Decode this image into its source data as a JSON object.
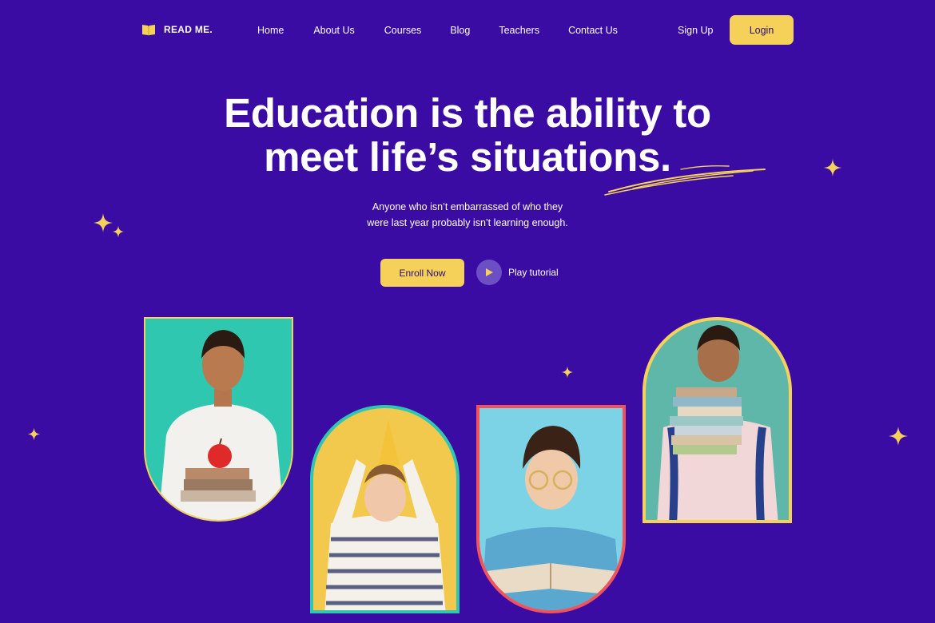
{
  "brand": {
    "name": "READ ME.",
    "icon": "book-icon"
  },
  "nav": {
    "links": [
      "Home",
      "About Us",
      "Courses",
      "Blog",
      "Teachers",
      "Contact Us"
    ],
    "signup": "Sign Up",
    "login": "Login"
  },
  "hero": {
    "title_line1": "Education is the ability to",
    "title_line2": "meet life’s situations.",
    "subtitle_line1": "Anyone who isn’t embarrassed of who they",
    "subtitle_line2": "were last year probably isn’t learning enough.",
    "enroll": "Enroll Now",
    "play": "Play tutorial",
    "play_icon": "play-icon"
  },
  "colors": {
    "background": "#3a0ca3",
    "accent_yellow": "#f5d15a",
    "teal": "#2fc7b0",
    "coral": "#f0535b",
    "sky": "#7dd3e6"
  },
  "cards": [
    {
      "name": "boy-with-apple-and-books",
      "frame": "#f5d15a",
      "bg": "#2fc7b0"
    },
    {
      "name": "child-with-party-hat",
      "frame": "#2fc7b0",
      "bg": "#f2c94c"
    },
    {
      "name": "boy-reading-with-glasses",
      "frame": "#f0535b",
      "bg": "#7dd3e6"
    },
    {
      "name": "boy-holding-books",
      "frame": "#f5d15a",
      "bg": "#5fb7aa"
    }
  ]
}
